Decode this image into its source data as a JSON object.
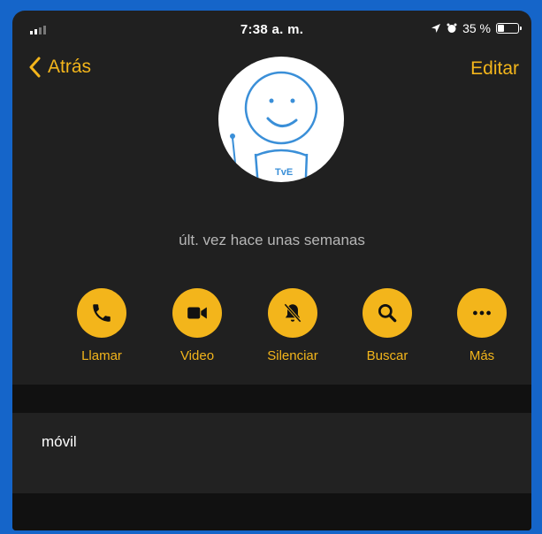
{
  "status_bar": {
    "time": "7:38 a. m.",
    "battery_percent": "35 %",
    "battery_level": 0.35
  },
  "nav": {
    "back_label": "Atrás",
    "edit_label": "Editar"
  },
  "contact": {
    "last_seen": "últ. vez hace unas semanas",
    "avatar_text": "TvE"
  },
  "actions": [
    {
      "label": "Llamar",
      "icon": "phone-icon"
    },
    {
      "label": "Video",
      "icon": "video-camera-icon"
    },
    {
      "label": "Silenciar",
      "icon": "bell-slash-icon"
    },
    {
      "label": "Buscar",
      "icon": "search-icon"
    },
    {
      "label": "Más",
      "icon": "more-icon"
    }
  ],
  "phone": {
    "label": "móvil"
  },
  "colors": {
    "accent": "#f3b51b",
    "background": "#202020",
    "frame": "#1565c9"
  }
}
